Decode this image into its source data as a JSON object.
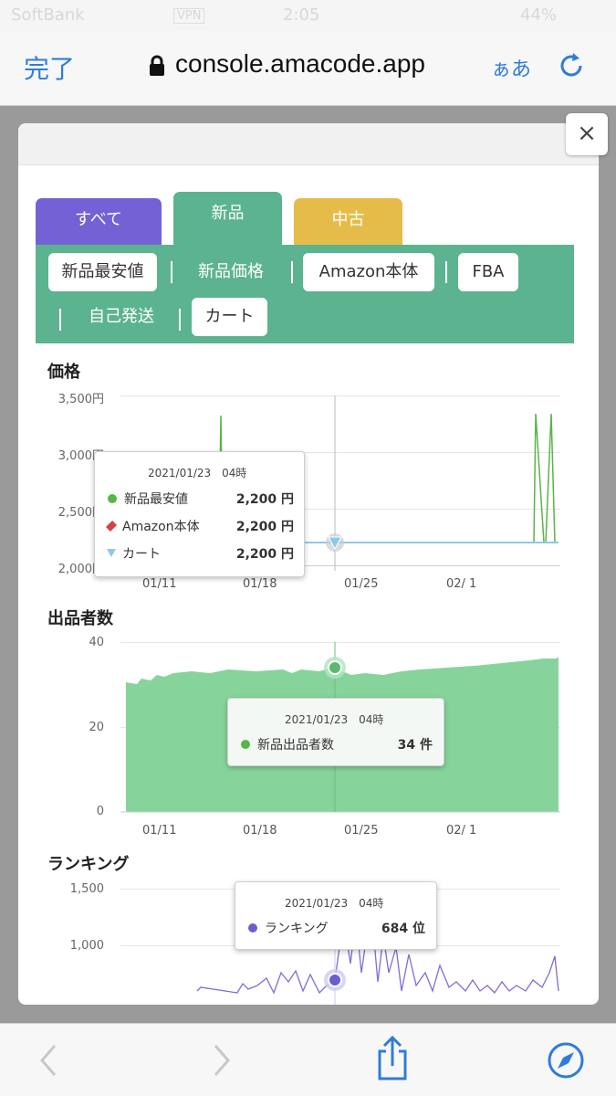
{
  "status": {
    "carrier": "SoftBank",
    "vpn": "VPN",
    "time": "2:05",
    "battery": "44%"
  },
  "browser": {
    "done": "完了",
    "url": "console.amacode.app",
    "aa": "ぁあ"
  },
  "modal": {
    "close": "×"
  },
  "tabs": [
    {
      "label": "すべて"
    },
    {
      "label": "新品"
    },
    {
      "label": "中古"
    }
  ],
  "subtabs": [
    {
      "label": "新品最安値"
    },
    {
      "label": "新品価格"
    },
    {
      "label": "Amazon本体"
    },
    {
      "label": "FBA"
    },
    {
      "label": "自己発送"
    },
    {
      "label": "カート"
    }
  ],
  "colors": {
    "purple": "#7461d6",
    "green": "#5cb38f",
    "yellow": "#e5bc4a",
    "seriesGreen": "#58b548",
    "cart": "#8ec9e8",
    "area": "#86d49c",
    "rank": "#7b6fd6"
  },
  "price": {
    "title": "価格",
    "yticks": [
      "3,500円",
      "3,000円",
      "2,500円",
      "2,000円"
    ],
    "xticks": [
      "01/11",
      "01/18",
      "01/25",
      "02/ 1"
    ],
    "tooltip": {
      "date": "2021/01/23　04時",
      "rows": [
        {
          "label": "新品最安値",
          "value": "2,200 円"
        },
        {
          "label": "Amazon本体",
          "value": "2,200 円"
        },
        {
          "label": "カート",
          "value": "2,200 円"
        }
      ]
    }
  },
  "sellers": {
    "title": "出品者数",
    "yticks": [
      "40",
      "20",
      "0"
    ],
    "xticks": [
      "01/11",
      "01/18",
      "01/25",
      "02/ 1"
    ],
    "tooltip": {
      "date": "2021/01/23　04時",
      "rows": [
        {
          "label": "新品出品者数",
          "value": "34 件"
        }
      ]
    }
  },
  "ranking": {
    "title": "ランキング",
    "yticks": [
      "1,500",
      "1,000"
    ],
    "tooltip": {
      "date": "2021/01/23　04時",
      "rows": [
        {
          "label": "ランキング",
          "value": "684 位"
        }
      ]
    }
  }
}
